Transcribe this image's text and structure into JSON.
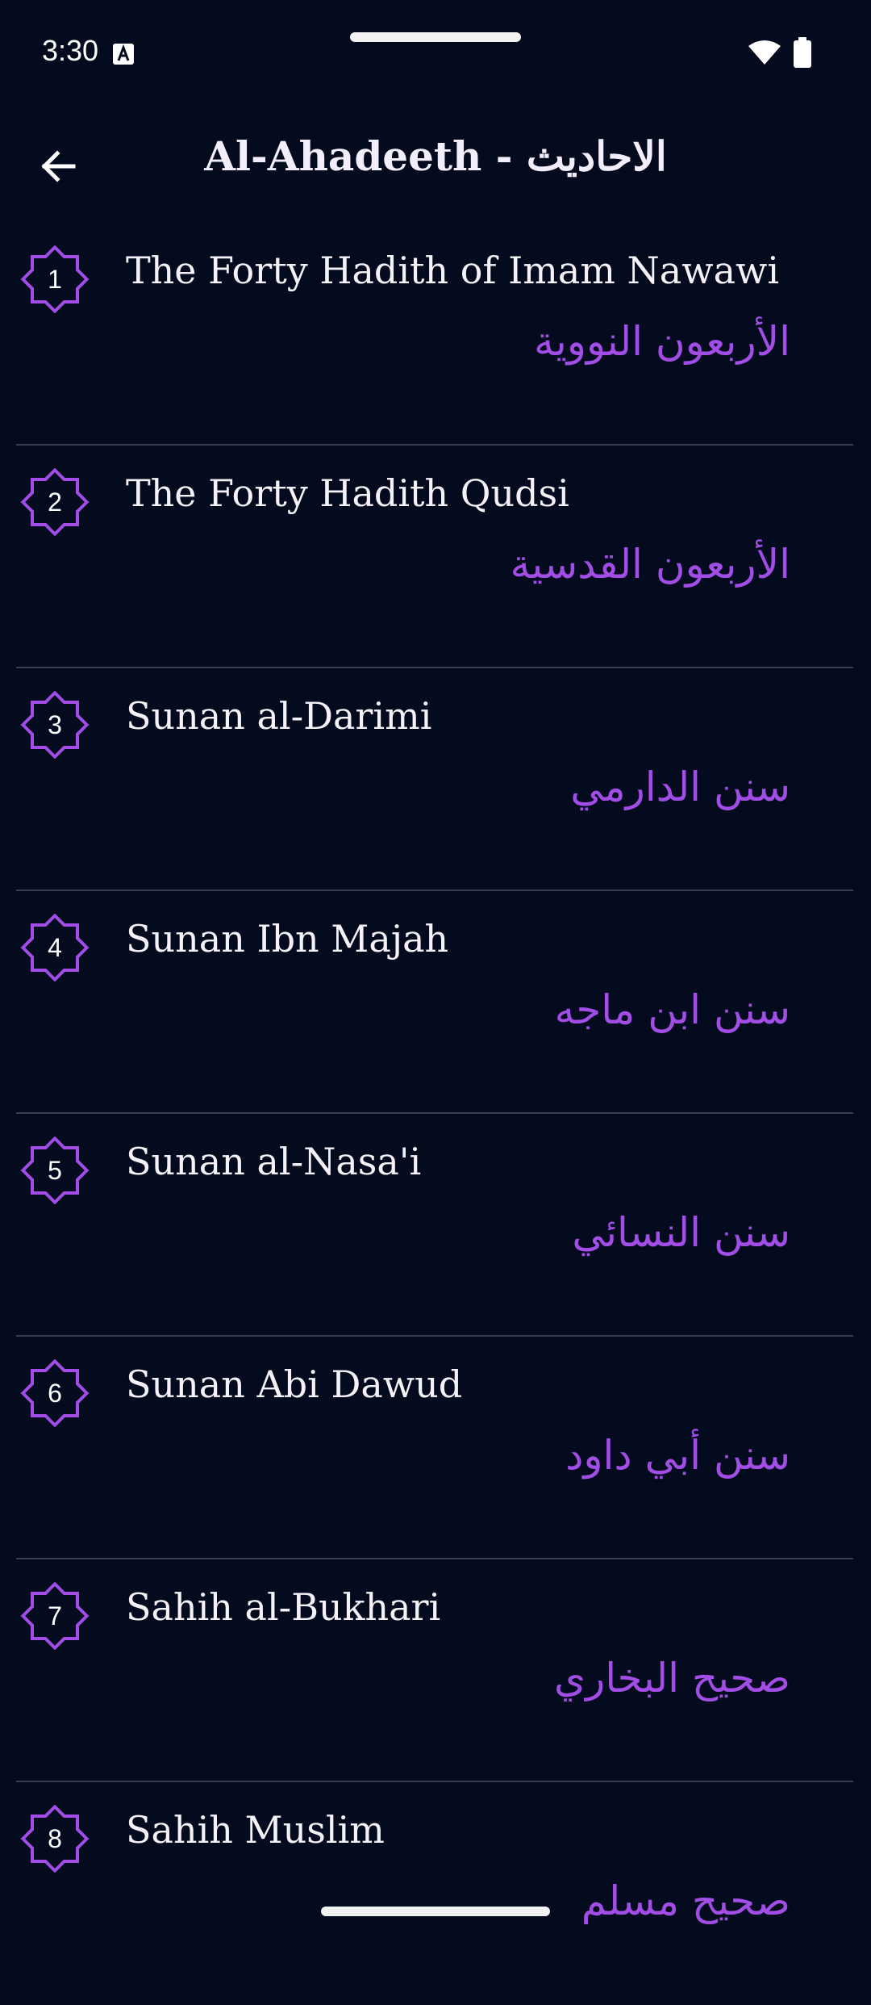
{
  "status_bar": {
    "time": "3:30"
  },
  "app_bar": {
    "title": "Al-Ahadeeth - الاحاديث"
  },
  "colors": {
    "background": "#050b1f",
    "accent": "#a24de6",
    "divider": "#3a3f50"
  },
  "items": [
    {
      "number": "1",
      "title_en": "The Forty Hadith of Imam Nawawi",
      "title_ar": "الأربعون النووية"
    },
    {
      "number": "2",
      "title_en": "The Forty Hadith Qudsi",
      "title_ar": "الأربعون القدسية"
    },
    {
      "number": "3",
      "title_en": "Sunan al-Darimi",
      "title_ar": "سنن الدارمي"
    },
    {
      "number": "4",
      "title_en": "Sunan Ibn Majah",
      "title_ar": "سنن ابن ماجه"
    },
    {
      "number": "5",
      "title_en": "Sunan al-Nasa'i",
      "title_ar": "سنن النسائي"
    },
    {
      "number": "6",
      "title_en": "Sunan Abi Dawud",
      "title_ar": "سنن أبي داود"
    },
    {
      "number": "7",
      "title_en": "Sahih al-Bukhari",
      "title_ar": "صحيح البخاري"
    },
    {
      "number": "8",
      "title_en": "Sahih Muslim",
      "title_ar": "صحيح مسلم"
    }
  ]
}
